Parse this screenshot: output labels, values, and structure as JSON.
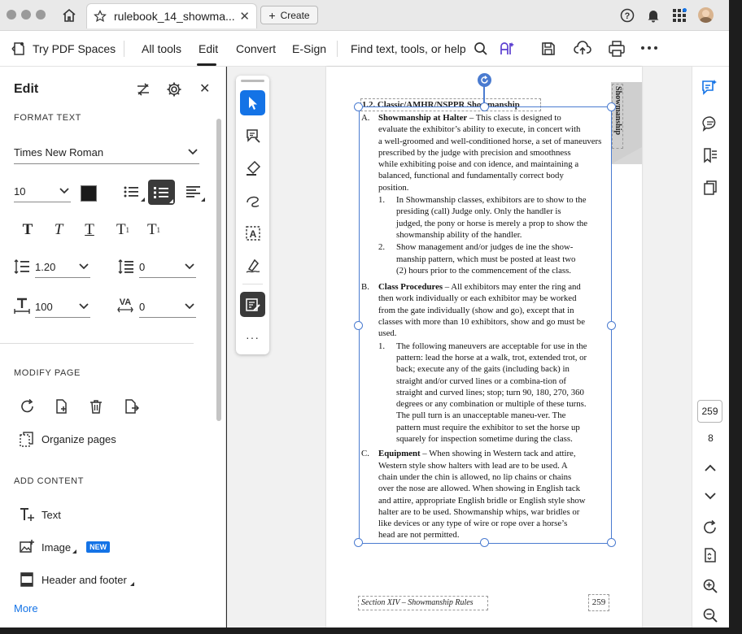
{
  "window": {
    "tab_title": "rulebook_14_showma...",
    "create_label": "Create"
  },
  "toolbar": {
    "try_pdf_spaces": "Try PDF Spaces",
    "all_tools": "All tools",
    "edit": "Edit",
    "convert": "Convert",
    "esign": "E-Sign",
    "find_placeholder": "Find text, tools, or help"
  },
  "edit_panel": {
    "title": "Edit",
    "format_text_heading": "FORMAT TEXT",
    "font_family": "Times New Roman",
    "font_size": "10",
    "line_spacing": "1.20",
    "paragraph_spacing": "0",
    "horizontal_scale": "100",
    "char_spacing": "0",
    "text_color": "#1a1a1a",
    "modify_page_heading": "MODIFY PAGE",
    "organize_pages": "Organize pages",
    "add_content_heading": "ADD CONTENT",
    "add_text": "Text",
    "add_image": "Image",
    "new_badge": "NEW",
    "add_header_footer": "Header and footer",
    "more": "More"
  },
  "document": {
    "heading": "1.2. Classic/AMHR/NSPPR Showmanship",
    "side_tab": "Showmanship",
    "a_label": "A.",
    "a_title": "Showmanship at Halter",
    "a_lines": [
      " – This class is designed to",
      "evaluate the exhibitor’s ability to execute, in concert with",
      "a well-groomed and well-conditioned horse, a set of maneuvers",
      "prescribed by the judge with precision and smoothness",
      "while exhibiting poise and con idence, and maintaining a",
      "balanced, functional and fundamentally correct body",
      "position."
    ],
    "a1_num": "1.",
    "a1_lines": [
      "In Showmanship classes, exhibitors are to show to the",
      "presiding (call) Judge only. Only the handler is",
      "judged, the pony or horse is merely a prop to show the",
      "showmanship ability of the handler."
    ],
    "a2_num": "2.",
    "a2_lines": [
      "Show management and/or judges de ine the show-",
      "manship pattern, which must be posted at least two",
      "(2) hours prior to the commencement of the class."
    ],
    "b_label": "B.",
    "b_title": "Class Procedures",
    "b_lines": [
      " – All exhibitors may enter the ring and",
      "then work individually or each exhibitor may be worked",
      "from the gate individually (show and go), except that in",
      "classes with more than 10 exhibitors, show and go must be",
      "used."
    ],
    "b1_num": "1.",
    "b1_lines": [
      "The following maneuvers are acceptable for use in the",
      "pattern: lead the horse at a walk, trot, extended trot, or",
      "back; execute any of the gaits (including back) in",
      "straight and/or curved lines or a combina-tion of",
      "straight and curved lines; stop; turn 90, 180, 270, 360",
      "degrees or any combination or multiple of these turns.",
      "The pull turn is an unacceptable maneu-ver. The",
      "pattern must require the exhibitor to set the horse up",
      "squarely for inspection sometime during the class."
    ],
    "c_label": "C.",
    "c_title": "Equipment",
    "c_lines": [
      " – When showing in Western tack and attire,",
      "Western style show halters with lead are to be used. A",
      "chain under the chin is allowed, no lip chains or chains",
      "over the nose are allowed. When showing in English tack",
      "and attire, appropriate English bridle or English style show",
      "halter are to be used. Showmanship whips, war bridles or",
      "like devices or any type of wire or rope over a horse’s",
      "head are not permitted."
    ],
    "footer_left": "Section XIV – Showmanship Rules",
    "footer_page": "259"
  },
  "right_rail": {
    "current_page": "259",
    "total_pages": "8"
  },
  "colors": {
    "accent_blue": "#1473e6",
    "selection_blue": "#4a7bd0",
    "badge_blue": "#1473e6"
  }
}
